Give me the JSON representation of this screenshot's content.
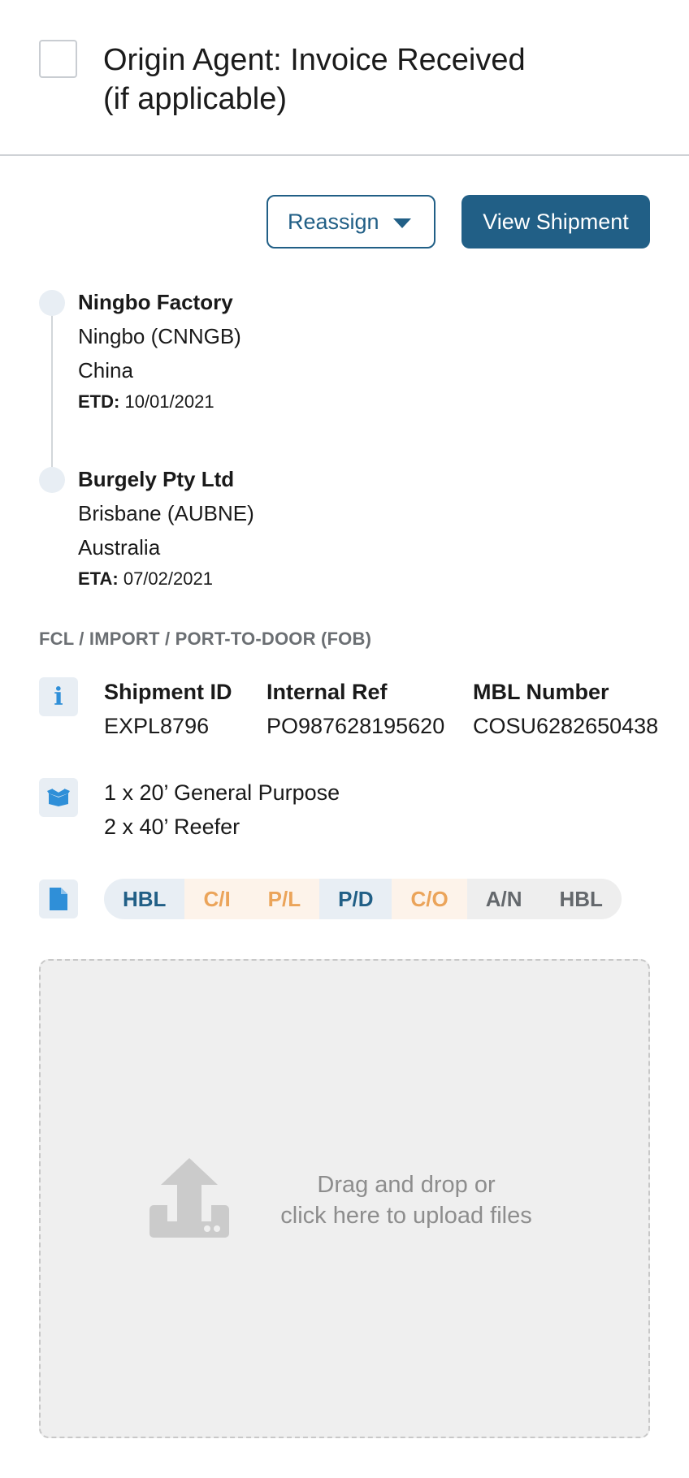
{
  "task": {
    "title_line1": "Origin Agent: Invoice Received",
    "title_line2": "(if applicable)"
  },
  "actions": {
    "reassign_label": "Reassign",
    "view_shipment_label": "View Shipment"
  },
  "route": {
    "origin": {
      "name": "Ningbo Factory",
      "port": "Ningbo (CNNGB)",
      "country": "China",
      "date_label": "ETD:",
      "date": "10/01/2021"
    },
    "destination": {
      "name": "Burgely Pty Ltd",
      "port": "Brisbane (AUBNE)",
      "country": "Australia",
      "date_label": "ETA:",
      "date": "07/02/2021"
    }
  },
  "shipment": {
    "mode": "FCL / IMPORT / PORT-TO-DOOR (FOB)",
    "fields": [
      {
        "label": "Shipment ID",
        "value": "EXPL8796"
      },
      {
        "label": "Internal Ref",
        "value": "PO987628195620"
      },
      {
        "label": "MBL Number",
        "value": "COSU6282650438"
      }
    ],
    "containers": [
      "1 x 20’ General Purpose",
      "2 x 40’ Reefer"
    ]
  },
  "documents": [
    {
      "label": "HBL",
      "status": "blue"
    },
    {
      "label": "C/I",
      "status": "orange"
    },
    {
      "label": "P/L",
      "status": "orange"
    },
    {
      "label": "P/D",
      "status": "blue"
    },
    {
      "label": "C/O",
      "status": "orange"
    },
    {
      "label": "A/N",
      "status": "grey"
    },
    {
      "label": "HBL",
      "status": "grey"
    }
  ],
  "upload": {
    "line1": "Drag and drop or",
    "line2": "click here to upload files"
  },
  "colors": {
    "primary": "#215f86",
    "info_icon": "#2f8fd8",
    "status_blue_text": "#215f86",
    "status_orange_text": "#eba45a",
    "status_grey_text": "#64686c"
  }
}
